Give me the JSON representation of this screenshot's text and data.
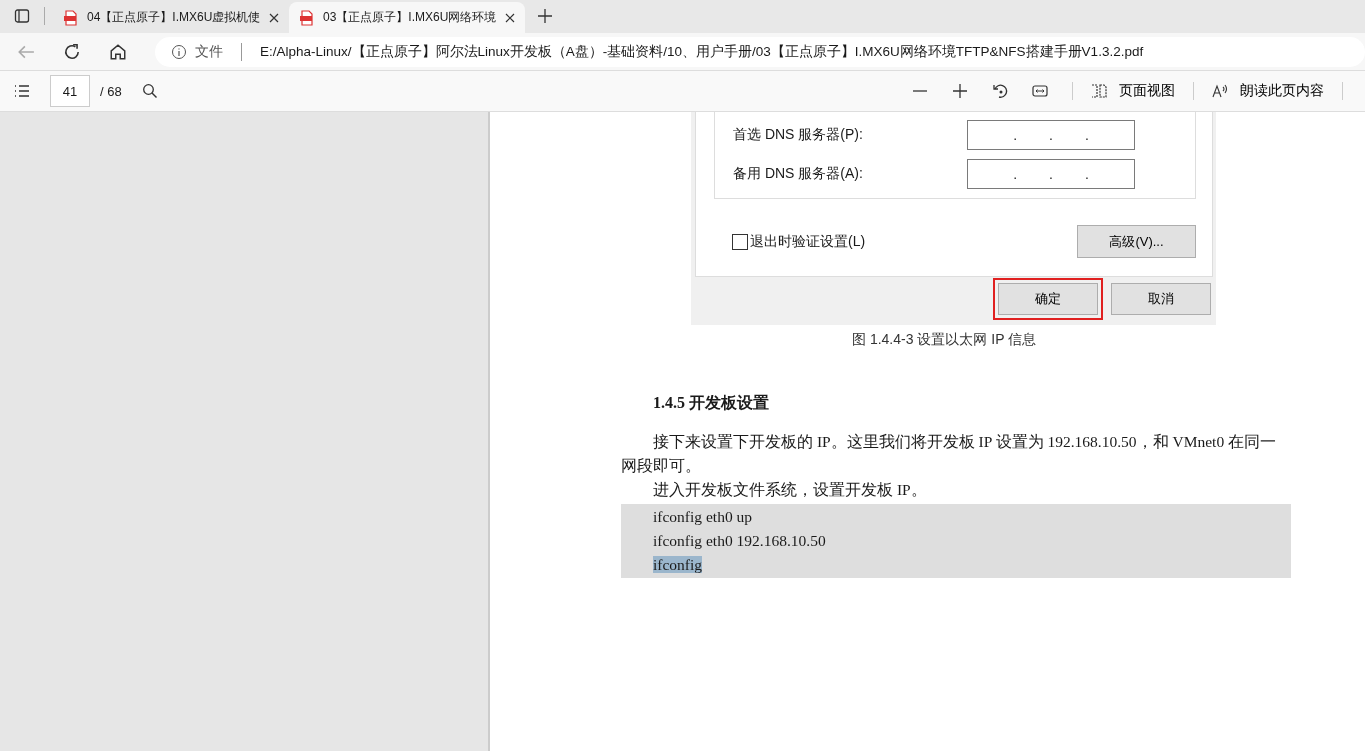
{
  "tabs": [
    {
      "title": "04【正点原子】I.MX6U虚拟机使",
      "selected": false
    },
    {
      "title": "03【正点原子】I.MX6U网络环境",
      "selected": true
    }
  ],
  "address_bar": {
    "scheme_label": "文件",
    "url": "E:/Alpha-Linux/【正点原子】阿尔法Linux开发板（A盘）-基础资料/10、用户手册/03【正点原子】I.MX6U网络环境TFTP&NFS搭建手册V1.3.2.pdf"
  },
  "pdf_toolbar": {
    "page": "41",
    "page_count": "/ 68",
    "page_view": "页面视图",
    "read_aloud": "朗读此页内容"
  },
  "document": {
    "dialog": {
      "fields": [
        {
          "label": "首选 DNS 服务器(P):",
          "dots": [
            ".",
            ".",
            "."
          ]
        },
        {
          "label": "备用 DNS 服务器(A):",
          "dots": [
            ".",
            ".",
            "."
          ]
        }
      ],
      "validate_checkbox": {
        "label": "退出时验证设置(L)",
        "checked": false
      },
      "advanced_button": "高级(V)...",
      "buttons": [
        {
          "label": "确定",
          "highlighted": true
        },
        {
          "label": "取消",
          "highlighted": false
        }
      ]
    },
    "caption": "图  1.4.4-3  设置以太网 IP 信息",
    "heading": "1.4.5 开发板设置",
    "paragraphs": [
      "接下来设置下开发板的 IP。这里我们将开发板 IP 设置为 192.168.10.50，和 VMnet0 在同一网段即可。",
      "进入开发板文件系统，设置开发板 IP。"
    ],
    "code_lines": [
      {
        "text": "ifconfig eth0 up",
        "selected": false
      },
      {
        "text": "ifconfig eth0 192.168.10.50",
        "selected": false
      },
      {
        "text": "ifconfig",
        "selected": true
      }
    ]
  }
}
